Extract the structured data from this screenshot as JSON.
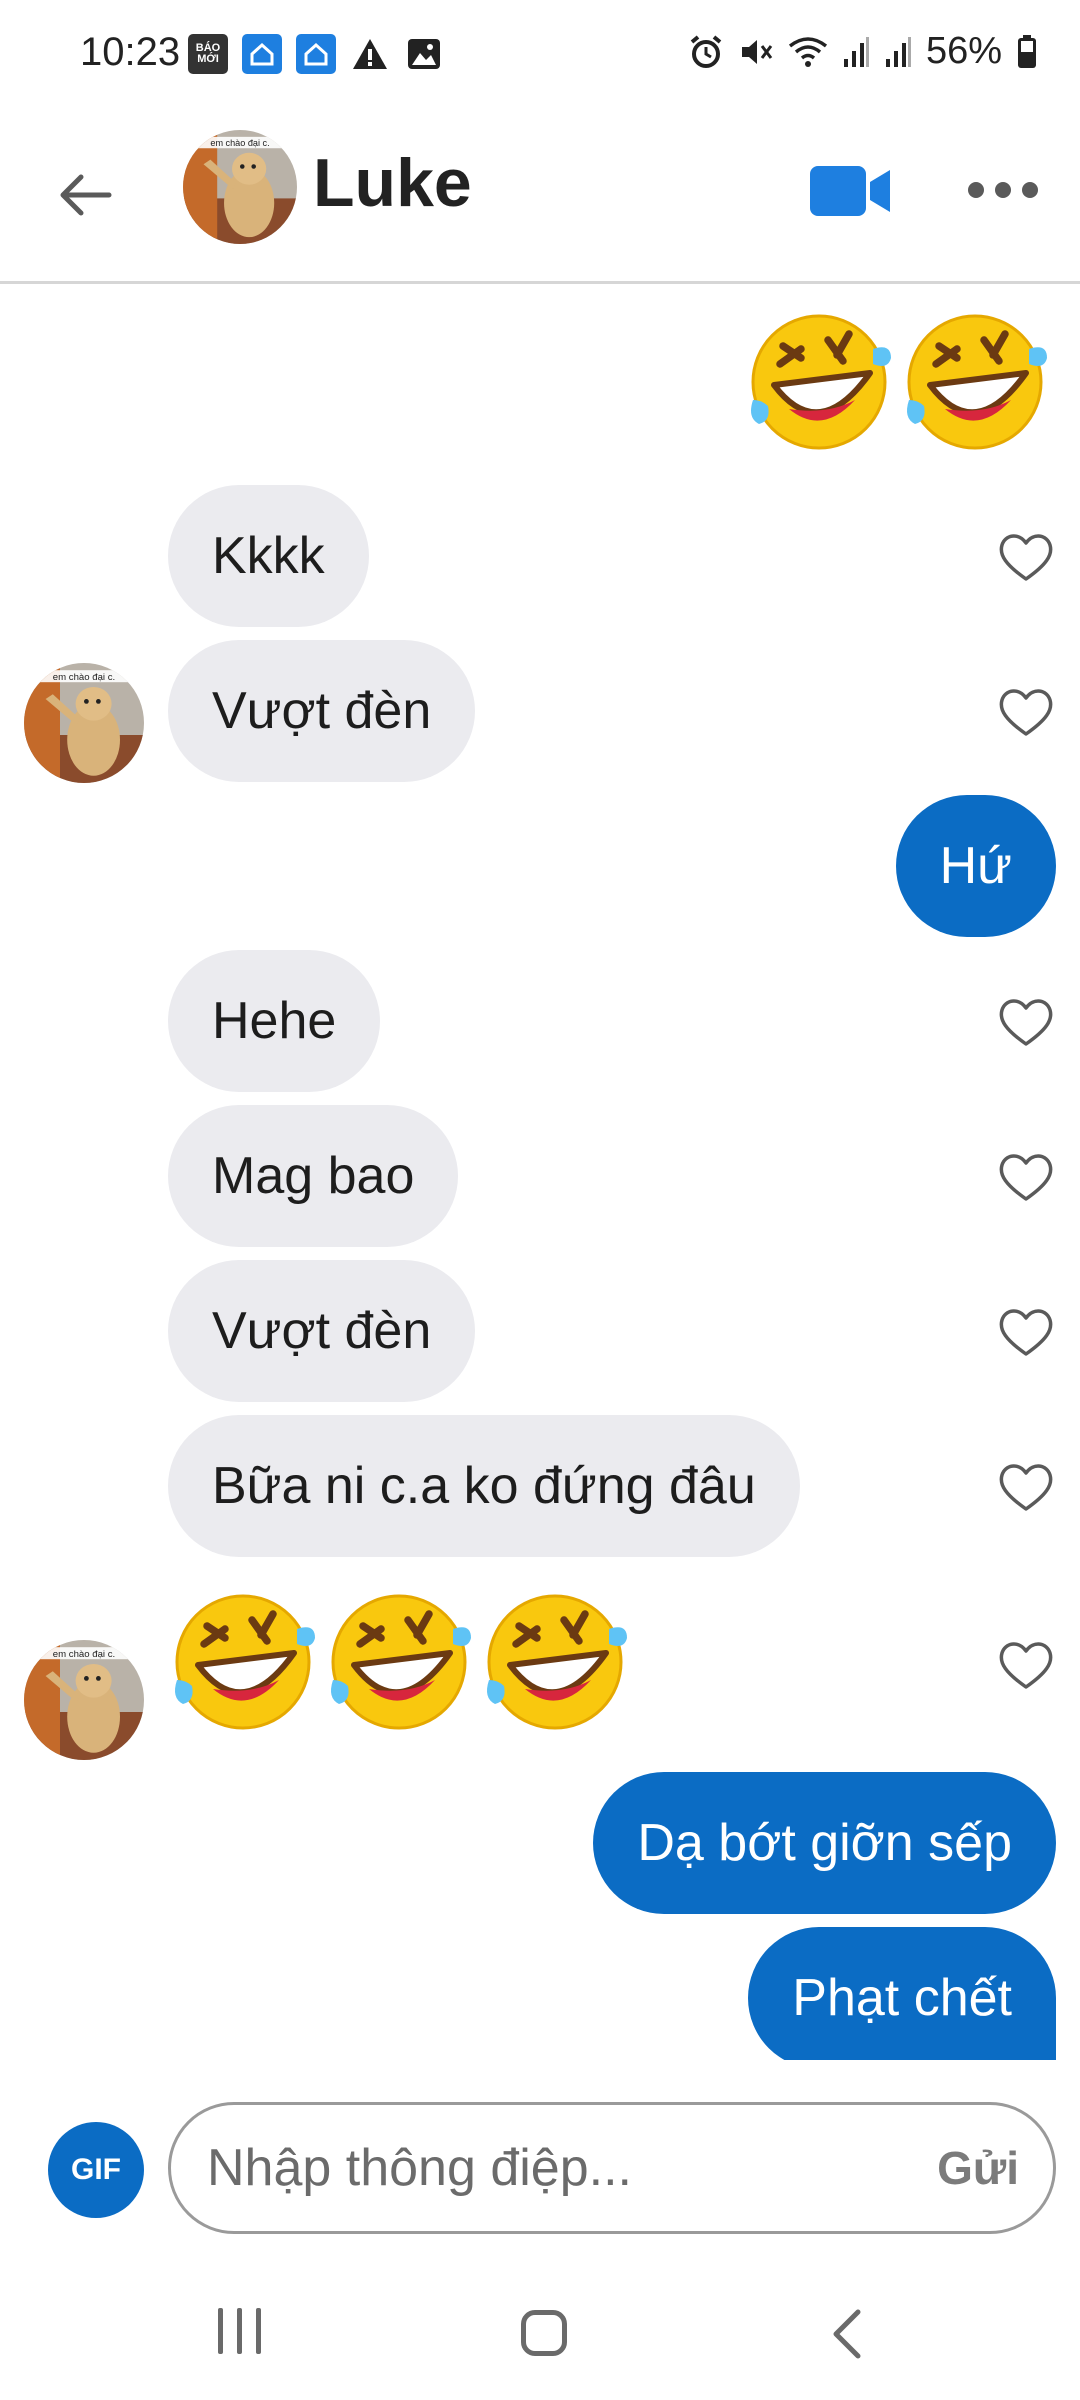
{
  "status_bar": {
    "time": "10:23",
    "left_icons": [
      "baomoi-icon",
      "home-notify-icon",
      "home-notify-icon",
      "warning-icon",
      "gallery-icon"
    ],
    "baomoi_label": "BÁO MỚI",
    "right_icons": [
      "alarm-icon",
      "mute-icon",
      "wifi-icon",
      "signal-icon",
      "signal-icon",
      "battery-icon"
    ],
    "battery": "56%"
  },
  "header": {
    "contact_name": "Luke",
    "avatar_caption": "Em chào đại ca",
    "actions": [
      "back-arrow-icon",
      "video-call-icon",
      "more-icon"
    ]
  },
  "messages": [
    {
      "from": "me",
      "type": "emoji",
      "emoji": "🤣🤣"
    },
    {
      "from": "them",
      "type": "text",
      "text": "Kkkk"
    },
    {
      "from": "them",
      "type": "text",
      "text": "Vượt đèn"
    },
    {
      "from": "me",
      "type": "text",
      "text": "Hứ"
    },
    {
      "from": "them",
      "type": "text",
      "text": "Hehe"
    },
    {
      "from": "them",
      "type": "text",
      "text": "Mag bao"
    },
    {
      "from": "them",
      "type": "text",
      "text": "Vượt đèn"
    },
    {
      "from": "them",
      "type": "text",
      "text": "Bữa ni c.a ko đứng đâu"
    },
    {
      "from": "them",
      "type": "emoji",
      "emoji": "🤣🤣🤣"
    },
    {
      "from": "me",
      "type": "text",
      "text": "Dạ bớt giỡn sếp"
    },
    {
      "from": "me",
      "type": "text",
      "text": "Phạt chết"
    }
  ],
  "composer": {
    "gif_label": "GIF",
    "placeholder": "Nhập thông điệp...",
    "value": "",
    "send_label": "Gửi"
  },
  "colors": {
    "accent": "#0b6cc4",
    "incoming_bubble": "#ebebef",
    "icon_gray": "#5a5a5a"
  }
}
